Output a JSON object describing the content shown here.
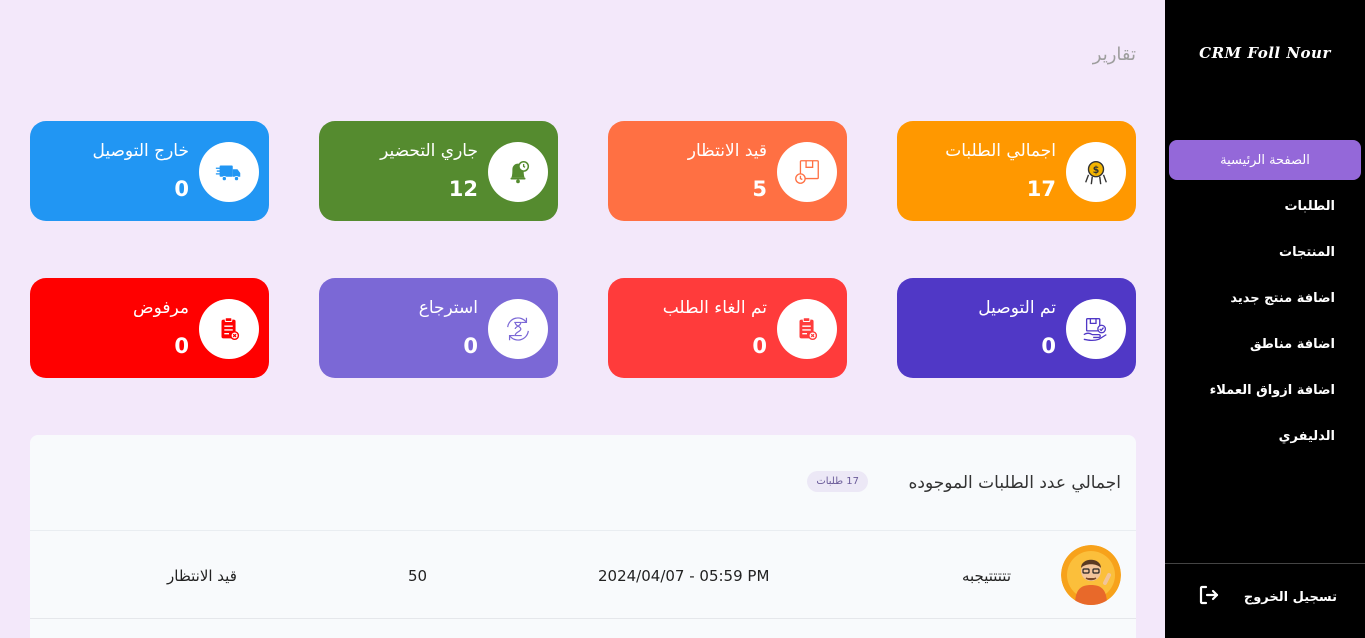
{
  "sidebar": {
    "brand": "CRM Foll Nour",
    "items": [
      {
        "label": "الصفحة الرئيسية",
        "active": true
      },
      {
        "label": "الطلبات"
      },
      {
        "label": "المنتجات"
      },
      {
        "label": "اضافة منتج جديد"
      },
      {
        "label": "اضافة مناطق"
      },
      {
        "label": "اضافة ازواق العملاء"
      },
      {
        "label": "الدليفري"
      }
    ],
    "logout_label": "تسجيل الخروج",
    "logout_icon": "logout-icon"
  },
  "page": {
    "title": "تقارير"
  },
  "cards": [
    {
      "label": "اجمالي الطلبات",
      "value": "17",
      "color": "#ff9800",
      "icon": "dollar-icon"
    },
    {
      "label": "قيد الانتظار",
      "value": "5",
      "color": "#ff7043",
      "icon": "pending-box-icon"
    },
    {
      "label": "جاري التحضير",
      "value": "12",
      "color": "#558b2f",
      "icon": "bell-clock-icon"
    },
    {
      "label": "خارج التوصيل",
      "value": "0",
      "color": "#2196f3",
      "icon": "delivery-truck-icon"
    },
    {
      "label": "تم التوصيل",
      "value": "0",
      "color": "#5038c6",
      "icon": "delivered-package-icon"
    },
    {
      "label": "تم الغاء الطلب",
      "value": "0",
      "color": "#ff3b3b",
      "icon": "cancelled-clipboard-icon"
    },
    {
      "label": "استرجاع",
      "value": "0",
      "color": "#7b68d6",
      "icon": "return-hourglass-icon"
    },
    {
      "label": "مرفوض",
      "value": "0",
      "color": "#ff0000",
      "icon": "rejected-clipboard-icon"
    }
  ],
  "orders_panel": {
    "title": "اجمالي عدد الطلبات الموجوده",
    "badge": "17 طلبات",
    "rows": [
      {
        "name": "تتتتتيجبه",
        "date": "2024/04/07 - 05:59 PM",
        "total": "50",
        "status": "قيد الانتظار"
      }
    ]
  }
}
